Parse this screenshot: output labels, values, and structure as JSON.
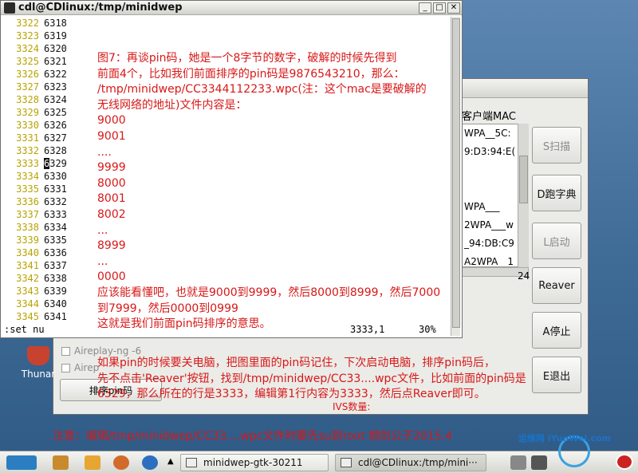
{
  "terminal": {
    "title": "cdl@CDlinux:/tmp/minidwep",
    "lines": [
      {
        "ln": "3322",
        "val": "6318"
      },
      {
        "ln": "3323",
        "val": "6319"
      },
      {
        "ln": "3324",
        "val": "6320"
      },
      {
        "ln": "3325",
        "val": "6321"
      },
      {
        "ln": "3326",
        "val": "6322"
      },
      {
        "ln": "3327",
        "val": "6323"
      },
      {
        "ln": "3328",
        "val": "6324"
      },
      {
        "ln": "3329",
        "val": "6325"
      },
      {
        "ln": "3330",
        "val": "6326"
      },
      {
        "ln": "3331",
        "val": "6327"
      },
      {
        "ln": "3332",
        "val": "6328"
      },
      {
        "ln": "3333",
        "val": "6329"
      },
      {
        "ln": "3334",
        "val": "6330"
      },
      {
        "ln": "3335",
        "val": "6331"
      },
      {
        "ln": "3336",
        "val": "6332"
      },
      {
        "ln": "3337",
        "val": "6333"
      },
      {
        "ln": "3338",
        "val": "6334"
      },
      {
        "ln": "3339",
        "val": "6335"
      },
      {
        "ln": "3340",
        "val": "6336"
      },
      {
        "ln": "3341",
        "val": "6337"
      },
      {
        "ln": "3342",
        "val": "6338"
      },
      {
        "ln": "3343",
        "val": "6339"
      },
      {
        "ln": "3344",
        "val": "6340"
      },
      {
        "ln": "3345",
        "val": "6341"
      }
    ],
    "cursor_line_index": 11,
    "command": ":set nu",
    "position": "3333,1",
    "percent": "30%"
  },
  "minidwep": {
    "column_header": "客户端MAC",
    "list_rows": [
      "WPA__5C:",
      "9:D3:94:E(",
      "",
      "",
      "WPA___",
      "2WPA___w",
      "_94:DB:C9",
      "A2WPA__1"
    ],
    "count": "24",
    "buttons": {
      "scan": "S扫描",
      "dict": "D跑字典",
      "start": "L启动",
      "reaver": "Reaver",
      "stop": "A停止",
      "exit": "E退出"
    },
    "options": [
      "Aireplay-ng -6",
      "Airep"
    ],
    "pin_sort_button": "排序pin码",
    "ivs_label": "IVS数量:"
  },
  "desktop": {
    "icon_label": "Thunar"
  },
  "annotation": {
    "top_lines": [
      "图7：再谈pin码，她是一个8字节的数字，破解的时候先得到",
      "前面4个，比如我们前面排序的pin码是9876543210，那么：",
      "/tmp/minidwep/CC3344112233.wpc(注：这个mac是要破解的",
      "无线网络的地址)文件内容是：",
      "9000",
      "9001",
      "....",
      "9999",
      "8000",
      "8001",
      "8002",
      "...",
      "8999",
      "...",
      "0000",
      "应该能看懂吧，也就是9000到9999，然后8000到8999，然后7000",
      "到7999，然后0000到0999",
      "这就是我们前面pin码排序的意思。"
    ],
    "bottom_lines": [
      "如果pin的时候要关电脑，把图里面的pin码记住，下次启动电脑，排序pin码后，",
      "先不点击'Reaver'按钮，找到/tmp/minidwep/CC33....wpc文件，比如前面的pin码是",
      "6329，那么所在的行是3333，编辑第1行内容为3333，然后点Reaver即可。"
    ],
    "footer": "注意：编辑/tmp/minidwep/CC33....wpc文件时要先su到root        拥剑公子2015.4"
  },
  "taskbar": {
    "tasks": [
      "minidwep-gtk-30211",
      "cdl@CDlinux:/tmp/mini···"
    ],
    "watermark": "运维网 iYunWei.com"
  },
  "colors": {
    "annotation": "#d81818",
    "line_numbers": "#b8a300"
  }
}
